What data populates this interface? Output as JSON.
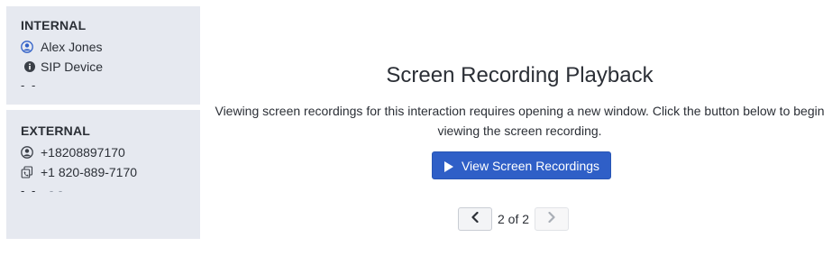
{
  "internal": {
    "title": "INTERNAL",
    "user_name": "Alex Jones",
    "device": "SIP Device",
    "dashes": "- -"
  },
  "external": {
    "title": "EXTERNAL",
    "caller_id": "+18208897170",
    "phone": "+1 820-889-7170",
    "dashes": "- -",
    "faint_dashes": "- -"
  },
  "playback": {
    "title": "Screen Recording Playback",
    "description_line1": "Viewing screen recordings for this interaction requires opening a new window. Click the button below to begin",
    "description_line2": "viewing the screen recording.",
    "button_label": "View Screen Recordings"
  },
  "pagination": {
    "label": "2 of 2"
  },
  "colors": {
    "panel_bg": "#e6e9f0",
    "button_bg": "#2f5fc7",
    "text": "#2b2f36",
    "icon_blue": "#2f5fc7"
  },
  "icons": {
    "user": "user-circle-icon",
    "info": "info-circle-icon",
    "copy": "copy-phone-icon",
    "play": "play-icon",
    "prev": "chevron-left-icon",
    "next": "chevron-right-icon"
  }
}
